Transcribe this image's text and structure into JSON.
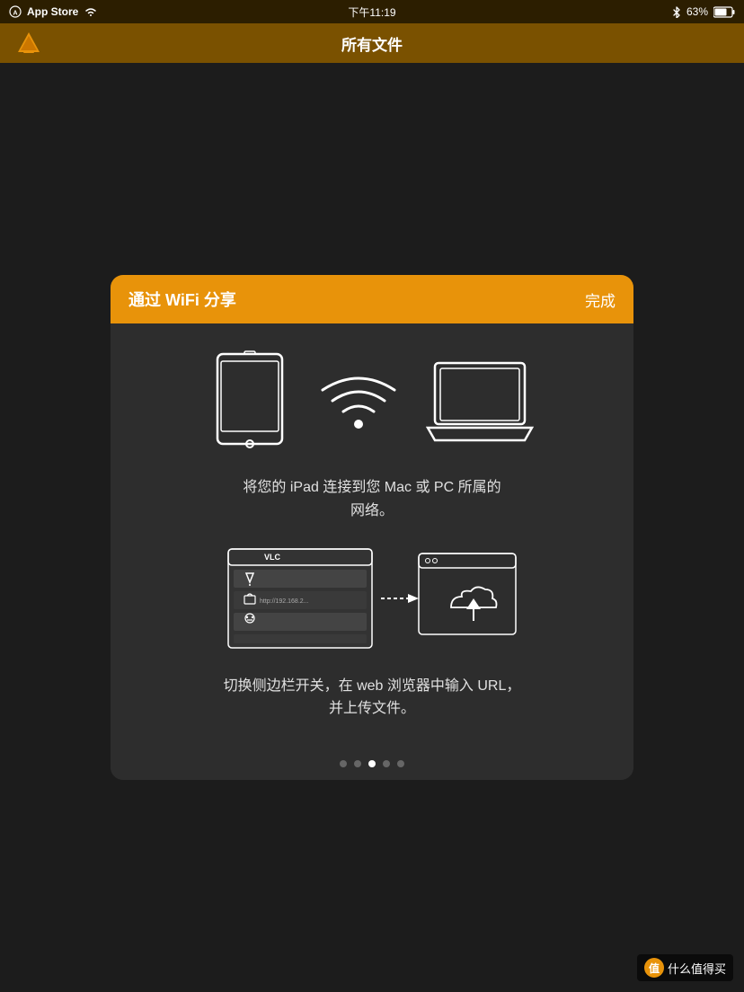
{
  "statusBar": {
    "appStore": "App Store",
    "wifi": true,
    "time": "下午11:19",
    "bluetooth": true,
    "battery": "63%"
  },
  "navBar": {
    "title": "所有文件"
  },
  "dialog": {
    "title": "通过 WiFi 分享",
    "doneButton": "完成",
    "description1": "将您的 iPad 连接到您 Mac 或 PC 所属的\n网络。",
    "description2": "切换侧边栏开关，在 web 浏览器中输入 URL，\n并上传文件。"
  },
  "pagination": {
    "dots": [
      1,
      2,
      3,
      4,
      5
    ],
    "activeIndex": 2
  },
  "watermark": {
    "icon": "值",
    "text": "什么值得买"
  }
}
